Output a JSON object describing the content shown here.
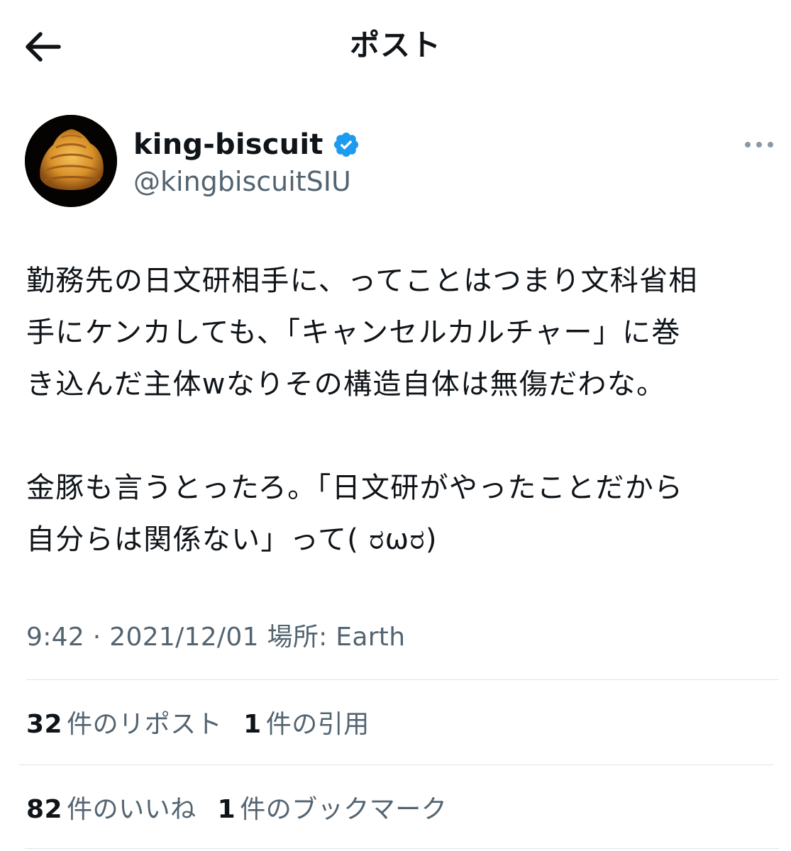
{
  "header": {
    "title": "ポスト",
    "back_icon": "arrow-left-icon"
  },
  "author": {
    "display_name": "king-biscuit",
    "handle": "@kingbiscuitSIU",
    "verified_icon": "verified-badge-icon",
    "more_icon": "more-horizontal-icon"
  },
  "tweet": {
    "paragraph_1": "勤務先の日文研相手に、ってことはつまり文科省相\n手にケンカしても、「キャンセルカルチャー」に巻\nき込んだ主体wなりその構造自体は無傷だわな。",
    "paragraph_2": "金豚も言うとったろ。「日文研がやったことだから\n自分らは関係ない」って( ರωರ)"
  },
  "meta": {
    "time": "9:42",
    "separator": " · ",
    "date": "2021/12/01",
    "location_prefix": " 場所: ",
    "location": "Earth"
  },
  "stats": {
    "reposts": {
      "count": "32",
      "label": "件のリポスト"
    },
    "quotes": {
      "count": "1",
      "label": "件の引用"
    },
    "likes": {
      "count": "82",
      "label": "件のいいね"
    },
    "bookmarks": {
      "count": "1",
      "label": "件のブックマーク"
    }
  },
  "colors": {
    "text": "#0f1419",
    "secondary": "#536471",
    "verified": "#1d9bf0",
    "divider": "#dfe3e6"
  }
}
